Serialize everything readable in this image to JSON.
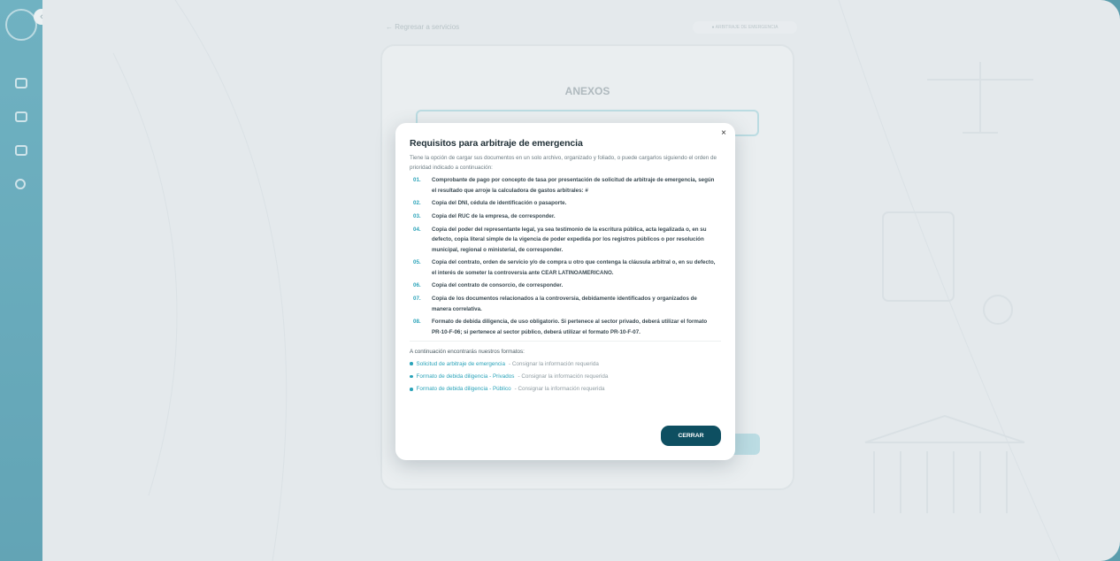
{
  "background": {
    "breadcrumb": "←  Regresar a servicios",
    "badge": "● ARBITRAJE DE EMERGENCIA",
    "card_title": "ANEXOS"
  },
  "modal": {
    "title": "Requisitos para arbitraje de emergencia",
    "intro": "Tiene la opción de cargar sus documentos en un solo archivo, organizado y foliado, o puede cargarlos siguiendo el orden de prioridad indicado a continuación:",
    "close_label": "×",
    "requirements": [
      {
        "num": "01.",
        "text": "Comprobante de pago por concepto de tasa por presentación de solicitud de arbitraje de emergencia, según el resultado que arroje la calculadora de gastos arbitrales: #"
      },
      {
        "num": "02.",
        "text": "Copia del DNI, cédula de identificación o pasaporte."
      },
      {
        "num": "03.",
        "text": "Copia del RUC de la empresa, de corresponder."
      },
      {
        "num": "04.",
        "text": "Copia del poder del representante legal, ya sea testimonio de la escritura pública, acta legalizada o, en su defecto, copia literal simple de la vigencia de poder expedida por los registros públicos o por resolución municipal, regional o ministerial, de corresponder."
      },
      {
        "num": "05.",
        "text": "Copia del contrato, orden de servicio y/o de compra u otro que contenga la cláusula arbitral o, en su defecto, el interés de someter la controversia ante CEAR LATINOAMERICANO."
      },
      {
        "num": "06.",
        "text": "Copia del contrato de consorcio, de corresponder."
      },
      {
        "num": "07.",
        "text": "Copia de los documentos relacionados a la controversia, debidamente identificados y organizados de manera correlativa."
      },
      {
        "num": "08.",
        "text": "Formato de debida diligencia, de uso obligatorio. Si pertenece al sector privado, deberá utilizar el formato PR-10-F-06; si pertenece al sector público, deberá utilizar el formato PR-10-F-07."
      }
    ],
    "formats_label": "A continuación encontrarás nuestros formatos:",
    "formats": [
      {
        "link": "Solicitud de arbitraje de emergencia",
        "note": "- Consignar la información requerida"
      },
      {
        "link": "Formato de debida diligencia - Privados",
        "note": "- Consignar la información requerida"
      },
      {
        "link": "Formato de debida diligencia - Público",
        "note": "- Consignar la información requerida"
      }
    ],
    "close_button": "CERRAR"
  },
  "colors": {
    "accent": "#2aa3b9",
    "primary_button": "#0e4f61",
    "sidebar": "#177a93"
  }
}
